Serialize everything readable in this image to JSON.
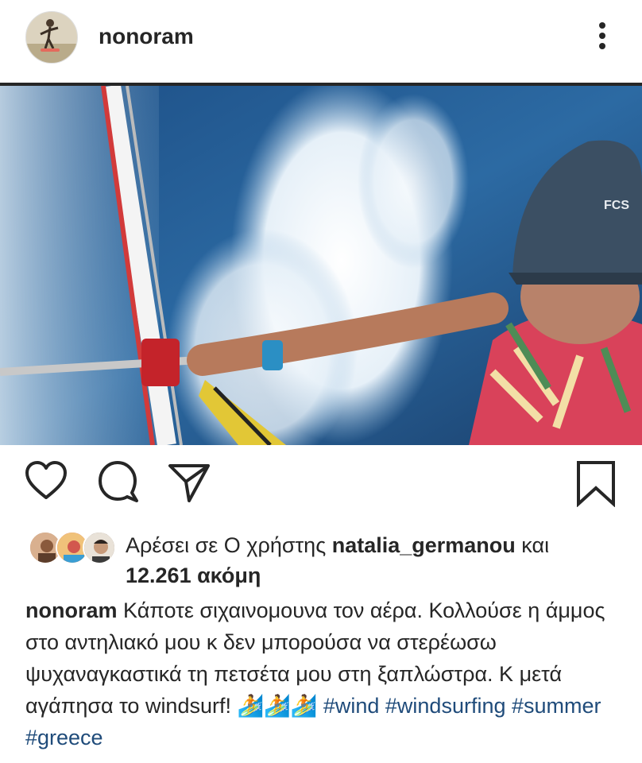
{
  "post": {
    "username": "nonoram",
    "more_icon": "more-vertical-icon",
    "image_description_icon": "post-photo",
    "actions": {
      "like_icon": "heart-icon",
      "comment_icon": "comment-icon",
      "share_icon": "send-icon",
      "save_icon": "bookmark-icon"
    },
    "likes": {
      "prefix": "Αρέσει σε Ο χρήστης ",
      "liker": "natalia_germanou",
      "suffix": " και",
      "count": "12.261 ακόμη"
    },
    "caption": {
      "username": "nonoram",
      "text": " Κάποτε σιχαινομουνα τον αέρα. Κολλούσε η άμμος στο αντηλιακό μου κ δεν μπορούσα να στερέωσω ψυχαναγκαστικά τη πετσέτα μου στη ξαπλώστρα. Κ μετά αγάπησα το windsurf! 🏄🏄🏄 ",
      "hashtags": [
        "#wind",
        "#windsurfing",
        "#summer",
        "#greece"
      ]
    }
  },
  "colors": {
    "text": "#262626",
    "hashtag": "#1f4b7a",
    "background": "#ffffff"
  }
}
